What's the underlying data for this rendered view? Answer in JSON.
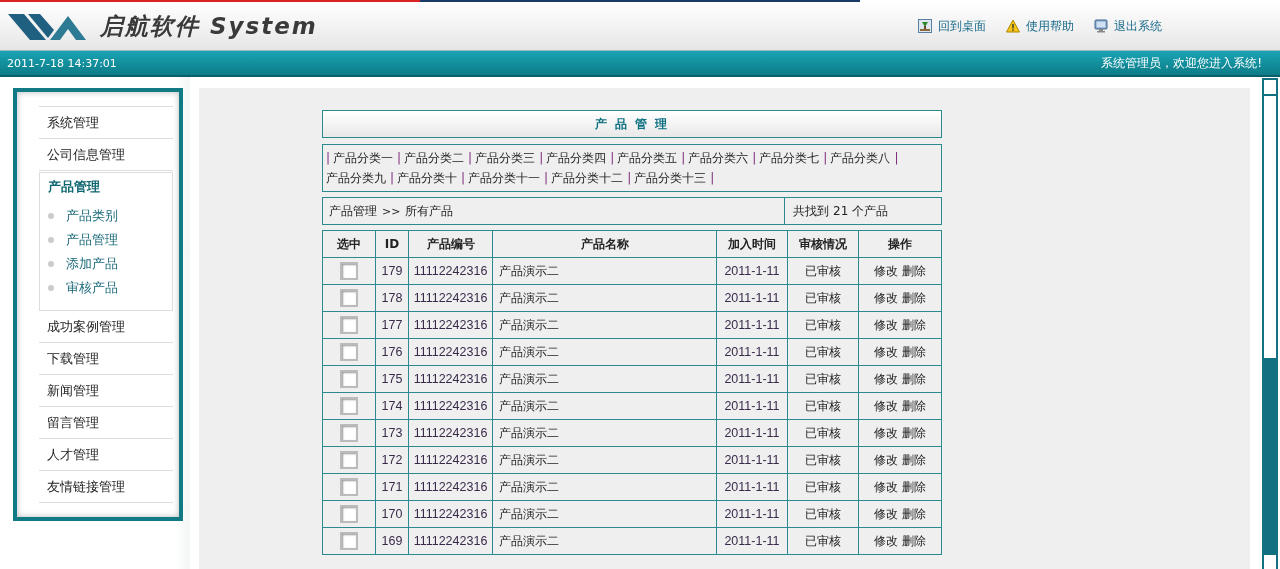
{
  "header": {
    "brand": "启航软件 System",
    "links": [
      {
        "label": "回到桌面",
        "kind": "desktop"
      },
      {
        "label": "使用帮助",
        "kind": "warning"
      },
      {
        "label": "退出系统",
        "kind": "monitor"
      }
    ]
  },
  "status_bar": {
    "datetime": "2011-7-18 14:37:01",
    "welcome": "系统管理员，欢迎您进入系统!"
  },
  "sidebar": {
    "items": [
      {
        "label": "系统管理",
        "expanded": false
      },
      {
        "label": "公司信息管理",
        "expanded": false
      },
      {
        "label": "产品管理",
        "expanded": true,
        "children": [
          {
            "label": "产品类别"
          },
          {
            "label": "产品管理"
          },
          {
            "label": "添加产品"
          },
          {
            "label": "审核产品"
          }
        ]
      },
      {
        "label": "成功案例管理",
        "expanded": false
      },
      {
        "label": "下载管理",
        "expanded": false
      },
      {
        "label": "新闻管理",
        "expanded": false
      },
      {
        "label": "留言管理",
        "expanded": false
      },
      {
        "label": "人才管理",
        "expanded": false
      },
      {
        "label": "友情链接管理",
        "expanded": false
      }
    ]
  },
  "panel": {
    "title": "产 品 管 理",
    "category_separator": "|",
    "categories": [
      "产品分类一",
      "产品分类二",
      "产品分类三",
      "产品分类四",
      "产品分类五",
      "产品分类六",
      "产品分类七",
      "产品分类八",
      "产品分类九",
      "产品分类十",
      "产品分类十一",
      "产品分类十二",
      "产品分类十三"
    ],
    "breadcrumb": {
      "section": "产品管理",
      "separator": ">>",
      "current": "所有产品"
    },
    "result": {
      "prefix": "共找到",
      "count": "21",
      "suffix": "个产品"
    }
  },
  "table": {
    "columns": [
      "选中",
      "ID",
      "产品编号",
      "产品名称",
      "加入时间",
      "审核情况",
      "操作"
    ],
    "rows": [
      {
        "checked": false,
        "id": "179",
        "code": "11112242316",
        "name": "产品演示二",
        "date": "2011-1-11",
        "status": "已审核",
        "actions": [
          "修改",
          "删除"
        ]
      },
      {
        "checked": false,
        "id": "178",
        "code": "11112242316",
        "name": "产品演示二",
        "date": "2011-1-11",
        "status": "已审核",
        "actions": [
          "修改",
          "删除"
        ]
      },
      {
        "checked": false,
        "id": "177",
        "code": "11112242316",
        "name": "产品演示二",
        "date": "2011-1-11",
        "status": "已审核",
        "actions": [
          "修改",
          "删除"
        ]
      },
      {
        "checked": false,
        "id": "176",
        "code": "11112242316",
        "name": "产品演示二",
        "date": "2011-1-11",
        "status": "已审核",
        "actions": [
          "修改",
          "删除"
        ]
      },
      {
        "checked": false,
        "id": "175",
        "code": "11112242316",
        "name": "产品演示二",
        "date": "2011-1-11",
        "status": "已审核",
        "actions": [
          "修改",
          "删除"
        ]
      },
      {
        "checked": false,
        "id": "174",
        "code": "11112242316",
        "name": "产品演示二",
        "date": "2011-1-11",
        "status": "已审核",
        "actions": [
          "修改",
          "删除"
        ]
      },
      {
        "checked": false,
        "id": "173",
        "code": "11112242316",
        "name": "产品演示二",
        "date": "2011-1-11",
        "status": "已审核",
        "actions": [
          "修改",
          "删除"
        ]
      },
      {
        "checked": false,
        "id": "172",
        "code": "11112242316",
        "name": "产品演示二",
        "date": "2011-1-11",
        "status": "已审核",
        "actions": [
          "修改",
          "删除"
        ]
      },
      {
        "checked": false,
        "id": "171",
        "code": "11112242316",
        "name": "产品演示二",
        "date": "2011-1-11",
        "status": "已审核",
        "actions": [
          "修改",
          "删除"
        ]
      },
      {
        "checked": false,
        "id": "170",
        "code": "11112242316",
        "name": "产品演示二",
        "date": "2011-1-11",
        "status": "已审核",
        "actions": [
          "修改",
          "删除"
        ]
      },
      {
        "checked": false,
        "id": "169",
        "code": "11112242316",
        "name": "产品演示二",
        "date": "2011-1-11",
        "status": "已审核",
        "actions": [
          "修改",
          "删除"
        ]
      }
    ]
  }
}
